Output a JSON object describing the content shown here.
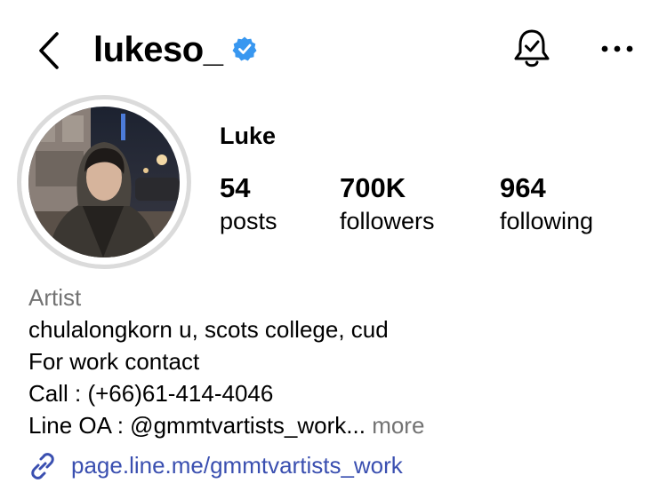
{
  "header": {
    "username": "lukeso_",
    "back_icon": "chevron-left-icon",
    "verified_icon": "verified-badge-icon",
    "notifications_icon": "bell-check-icon",
    "more_icon": "more-horizontal-icon"
  },
  "profile": {
    "display_name": "Luke",
    "avatar": "profile-photo"
  },
  "stats": [
    {
      "count": "54",
      "label": "posts"
    },
    {
      "count": "700K",
      "label": "followers"
    },
    {
      "count": "964",
      "label": "following"
    }
  ],
  "bio": {
    "category": "Artist",
    "lines": [
      "chulalongkorn u, scots college, cud",
      "For work contact",
      "Call : (+66)61-414-4046",
      "Line OA : @gmmtvartists_work..."
    ],
    "more_label": "more",
    "link_icon": "link-icon",
    "link": "page.line.me/gmmtvartists_work"
  },
  "colors": {
    "verified": "#3897f0",
    "muted_text": "#737373",
    "link": "#3a4fb0",
    "avatar_ring": "#dbdbdb"
  }
}
